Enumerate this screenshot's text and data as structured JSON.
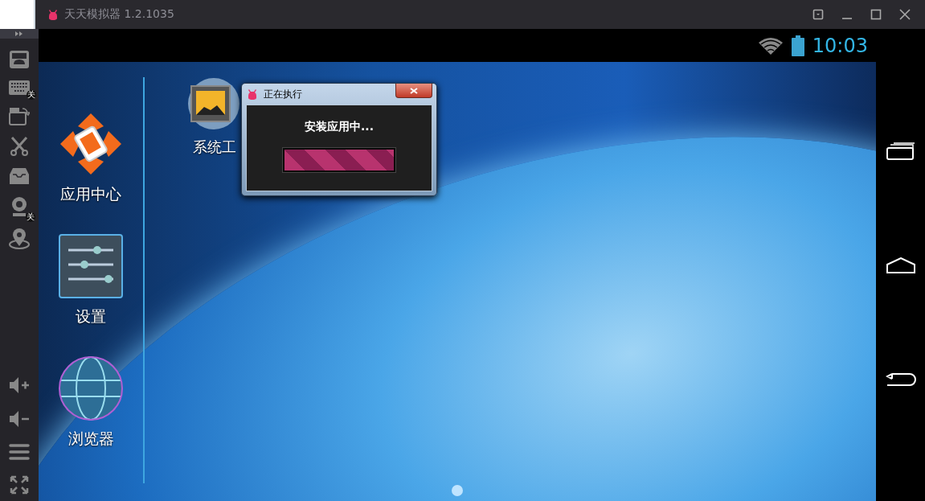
{
  "window": {
    "title": "天天模拟器 1.2.1035"
  },
  "sidebar": {
    "keyboard_badge": "关",
    "camera_badge": "关"
  },
  "status_bar": {
    "time": "10:03"
  },
  "dock": [
    {
      "label": "应用中心",
      "kind": "app-center"
    },
    {
      "label": "设置",
      "kind": "settings"
    },
    {
      "label": "浏览器",
      "kind": "browser"
    }
  ],
  "desktop_apps": [
    {
      "label": "系统工",
      "kind": "gallery"
    }
  ],
  "dialog": {
    "title": "正在执行",
    "message": "安装应用中...",
    "progress": {
      "level": 1
    }
  }
}
